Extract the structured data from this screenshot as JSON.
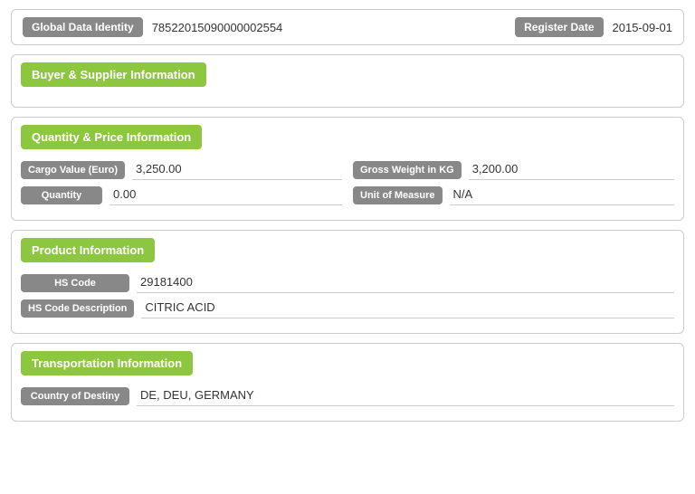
{
  "identity": {
    "gdi_label": "Global Data Identity",
    "gdi_value": "78522015090000002554",
    "register_label": "Register Date",
    "register_value": "2015-09-01"
  },
  "buyer_supplier": {
    "section_title": "Buyer & Supplier Information"
  },
  "quantity_price": {
    "section_title": "Quantity & Price Information",
    "cargo_label": "Cargo Value (Euro)",
    "cargo_value": "3,250.00",
    "gross_weight_label": "Gross Weight in KG",
    "gross_weight_value": "3,200.00",
    "quantity_label": "Quantity",
    "quantity_value": "0.00",
    "unit_label": "Unit of Measure",
    "unit_value": "N/A"
  },
  "product": {
    "section_title": "Product Information",
    "hs_code_label": "HS Code",
    "hs_code_value": "29181400",
    "hs_desc_label": "HS Code Description",
    "hs_desc_value": "CITRIC ACID"
  },
  "transportation": {
    "section_title": "Transportation Information",
    "country_label": "Country of Destiny",
    "country_value": "DE, DEU, GERMANY"
  }
}
